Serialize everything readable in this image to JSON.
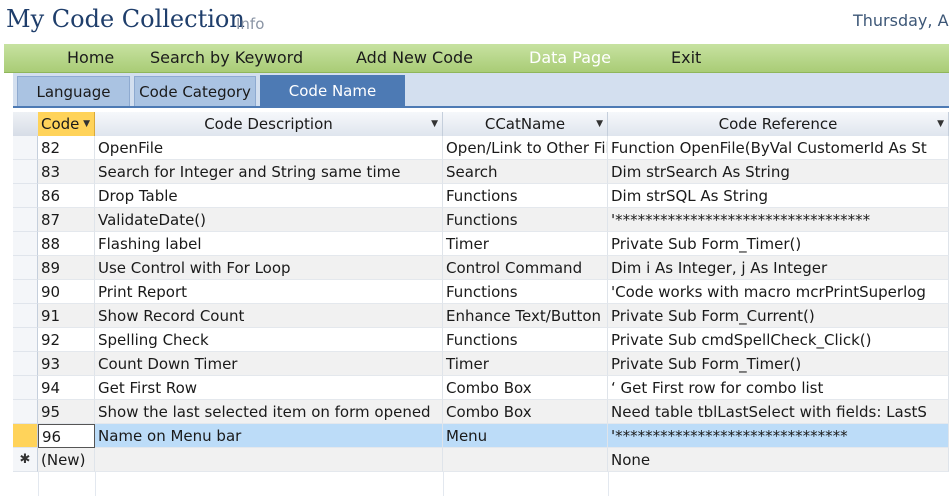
{
  "app": {
    "title": "My Code Collection",
    "subtitle": "Info",
    "date": "Thursday, A"
  },
  "menu": [
    {
      "label": "Home"
    },
    {
      "label": "Search by Keyword"
    },
    {
      "label": "Add New Code"
    },
    {
      "label": "Data Page",
      "active": true
    },
    {
      "label": "Exit"
    }
  ],
  "tabs": [
    {
      "label": "Language"
    },
    {
      "label": "Code Category"
    },
    {
      "label": "Code Name",
      "active": true
    }
  ],
  "grid": {
    "columns": [
      "Code",
      "Code Description",
      "CCatName",
      "Code Reference"
    ],
    "rows": [
      {
        "id": "82",
        "desc": "OpenFile",
        "cat": "Open/Link to Other Fil",
        "ref": "Function OpenFile(ByVal CustomerId As St"
      },
      {
        "id": "83",
        "desc": "Search for Integer and String same time",
        "cat": "Search",
        "ref": "Dim strSearch As String"
      },
      {
        "id": "86",
        "desc": "Drop Table",
        "cat": "Functions",
        "ref": "Dim strSQL As String"
      },
      {
        "id": "87",
        "desc": "ValidateDate()",
        "cat": "Functions",
        "ref": "'**********************************"
      },
      {
        "id": "88",
        "desc": "Flashing label",
        "cat": "Timer",
        "ref": "Private Sub Form_Timer()"
      },
      {
        "id": "89",
        "desc": "Use Control with For Loop",
        "cat": "Control Command",
        "ref": "   Dim i As Integer, j As Integer"
      },
      {
        "id": "90",
        "desc": "Print Report",
        "cat": "Functions",
        "ref": "'Code works with macro mcrPrintSuperlog"
      },
      {
        "id": "91",
        "desc": "Show Record Count",
        "cat": "Enhance Text/Button",
        "ref": "Private Sub Form_Current()"
      },
      {
        "id": "92",
        "desc": "Spelling Check",
        "cat": "Functions",
        "ref": "Private Sub cmdSpellCheck_Click()"
      },
      {
        "id": "93",
        "desc": "Count Down Timer",
        "cat": "Timer",
        "ref": "Private Sub Form_Timer()"
      },
      {
        "id": "94",
        "desc": "Get First Row",
        "cat": "Combo Box",
        "ref": "‘ Get First row for combo list"
      },
      {
        "id": "95",
        "desc": "Show the last selected item on form opened",
        "cat": "Combo Box",
        "ref": "Need table tblLastSelect with fields: LastS"
      },
      {
        "id": "96",
        "desc": "Name on Menu bar",
        "cat": "Menu",
        "ref": "   '*******************************",
        "current": true
      },
      {
        "id": "(New)",
        "desc": "",
        "cat": "",
        "ref": "None",
        "new": true,
        "marker": "✱"
      }
    ]
  }
}
